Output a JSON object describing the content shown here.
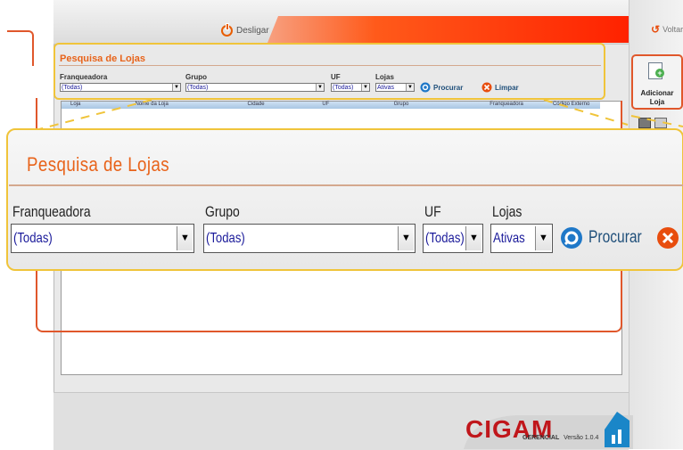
{
  "topbar": {
    "logout_label": "Desligar",
    "back_label": "Voltar"
  },
  "side": {
    "add_store_label": "Adicionar Loja"
  },
  "search": {
    "title": "Pesquisa de Lojas",
    "franqueadora": {
      "label": "Franqueadora",
      "value": "(Todas)"
    },
    "grupo": {
      "label": "Grupo",
      "value": "(Todas)"
    },
    "uf": {
      "label": "UF",
      "value": "(Todas)"
    },
    "lojas": {
      "label": "Lojas",
      "value": "Ativas"
    },
    "search_label": "Procurar",
    "clear_label": "Limpar"
  },
  "grid": {
    "columns": [
      "Loja",
      "Nome da Loja",
      "Cidade",
      "UF",
      "Grupo",
      "Franqueadora",
      "Código Externo"
    ]
  },
  "zoom": {
    "title": "Pesquisa de Lojas",
    "franqueadora": {
      "label": "Franqueadora",
      "value": "(Todas)"
    },
    "grupo": {
      "label": "Grupo",
      "value": "(Todas)"
    },
    "uf": {
      "label": "UF",
      "value": "(Todas)"
    },
    "lojas": {
      "label": "Lojas",
      "value": "Ativas"
    },
    "search_label": "Procurar",
    "clear_label": "L"
  },
  "footer": {
    "brand": "CIGAM",
    "sub": "GERENCIAL",
    "version": "Versão 1.0.4"
  },
  "colors": {
    "accent": "#e8631a",
    "highlight": "#f0c43a",
    "callout": "#e0572b"
  }
}
